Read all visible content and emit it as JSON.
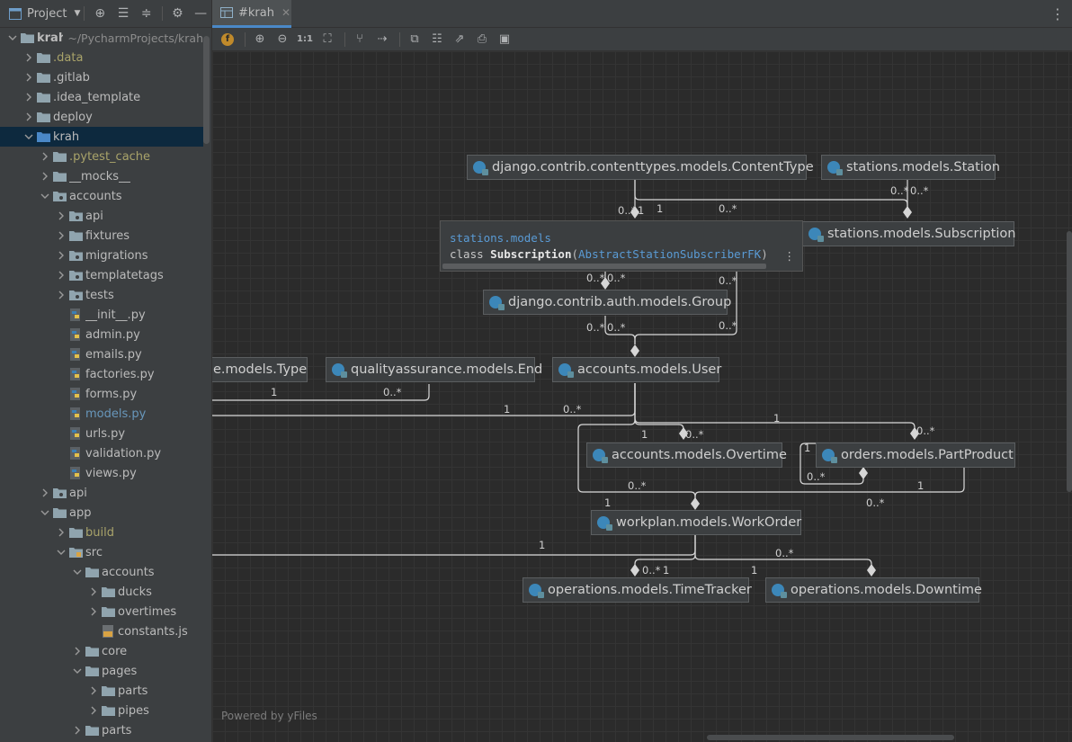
{
  "project_panel": {
    "title": "Project",
    "tree": [
      {
        "label": "krah",
        "path": "~/PycharmProjects/krah",
        "depth": 0,
        "type": "folder",
        "expanded": true,
        "bold": true
      },
      {
        "label": ".data",
        "depth": 1,
        "type": "folder",
        "expanded": false,
        "style": "excluded"
      },
      {
        "label": ".gitlab",
        "depth": 1,
        "type": "folder",
        "expanded": false
      },
      {
        "label": ".idea_template",
        "depth": 1,
        "type": "folder",
        "expanded": false
      },
      {
        "label": "deploy",
        "depth": 1,
        "type": "folder",
        "expanded": false
      },
      {
        "label": "krah",
        "depth": 1,
        "type": "folder-blue",
        "expanded": true,
        "selected": true
      },
      {
        "label": ".pytest_cache",
        "depth": 2,
        "type": "folder",
        "expanded": false,
        "style": "excluded"
      },
      {
        "label": "__mocks__",
        "depth": 2,
        "type": "folder",
        "expanded": false
      },
      {
        "label": "accounts",
        "depth": 2,
        "type": "folder-pkg",
        "expanded": true
      },
      {
        "label": "api",
        "depth": 3,
        "type": "folder-pkg",
        "expanded": false
      },
      {
        "label": "fixtures",
        "depth": 3,
        "type": "folder",
        "expanded": false
      },
      {
        "label": "migrations",
        "depth": 3,
        "type": "folder-pkg",
        "expanded": false
      },
      {
        "label": "templatetags",
        "depth": 3,
        "type": "folder-pkg",
        "expanded": false
      },
      {
        "label": "tests",
        "depth": 3,
        "type": "folder-pkg",
        "expanded": false
      },
      {
        "label": "__init__.py",
        "depth": 3,
        "type": "py"
      },
      {
        "label": "admin.py",
        "depth": 3,
        "type": "py"
      },
      {
        "label": "emails.py",
        "depth": 3,
        "type": "py"
      },
      {
        "label": "factories.py",
        "depth": 3,
        "type": "py"
      },
      {
        "label": "forms.py",
        "depth": 3,
        "type": "py"
      },
      {
        "label": "models.py",
        "depth": 3,
        "type": "py",
        "style": "modified"
      },
      {
        "label": "urls.py",
        "depth": 3,
        "type": "py"
      },
      {
        "label": "validation.py",
        "depth": 3,
        "type": "py"
      },
      {
        "label": "views.py",
        "depth": 3,
        "type": "py"
      },
      {
        "label": "api",
        "depth": 2,
        "type": "folder-pkg",
        "expanded": false
      },
      {
        "label": "app",
        "depth": 2,
        "type": "folder",
        "expanded": true
      },
      {
        "label": "build",
        "depth": 3,
        "type": "folder",
        "expanded": false,
        "style": "excluded"
      },
      {
        "label": "src",
        "depth": 3,
        "type": "folder-src",
        "expanded": true
      },
      {
        "label": "accounts",
        "depth": 4,
        "type": "folder",
        "expanded": true
      },
      {
        "label": "ducks",
        "depth": 5,
        "type": "folder",
        "expanded": false
      },
      {
        "label": "overtimes",
        "depth": 5,
        "type": "folder",
        "expanded": false
      },
      {
        "label": "constants.js",
        "depth": 5,
        "type": "js"
      },
      {
        "label": "core",
        "depth": 4,
        "type": "folder",
        "expanded": false
      },
      {
        "label": "pages",
        "depth": 4,
        "type": "folder",
        "expanded": true
      },
      {
        "label": "parts",
        "depth": 5,
        "type": "folder",
        "expanded": false
      },
      {
        "label": "pipes",
        "depth": 5,
        "type": "folder",
        "expanded": false
      },
      {
        "label": "parts",
        "depth": 4,
        "type": "folder",
        "expanded": false
      }
    ]
  },
  "editor": {
    "tab_label": "#krah"
  },
  "diagram": {
    "nodes": [
      {
        "id": "contenttype",
        "label": "django.contrib.contenttypes.models.ContentType"
      },
      {
        "id": "station",
        "label": "stations.models.Station"
      },
      {
        "id": "subscription",
        "label": "stations.models.Subscription"
      },
      {
        "id": "group",
        "label": "django.contrib.auth.models.Group"
      },
      {
        "id": "type",
        "label": "e.models.Type"
      },
      {
        "id": "qa_end",
        "label": "qualityassurance.models.End"
      },
      {
        "id": "user",
        "label": "accounts.models.User"
      },
      {
        "id": "overtime",
        "label": "accounts.models.Overtime"
      },
      {
        "id": "partproduct",
        "label": "orders.models.PartProduct"
      },
      {
        "id": "workorder",
        "label": "workplan.models.WorkOrder"
      },
      {
        "id": "timetracker",
        "label": "operations.models.TimeTracker"
      },
      {
        "id": "downtime",
        "label": "operations.models.Downtime"
      }
    ],
    "multiplicities": [
      "0..*",
      "1",
      "1",
      "0..*",
      "0..*",
      "0..*",
      "0..*",
      "0..*",
      "0..*",
      "0..*",
      "0..*",
      "0..*",
      "1",
      "0..*",
      "1",
      "0..*",
      "1",
      "1",
      "0..*",
      "0..*",
      "1",
      "0..*",
      "1",
      "0..*",
      "1",
      "0..*",
      "1",
      "0..*",
      "1",
      "1",
      "0..*"
    ],
    "tooltip": {
      "package": "stations.models",
      "keyword": "class",
      "class_name": "Subscription",
      "base_class": "AbstractStationSubscriberFK"
    },
    "powered_by": "Powered by yFiles"
  },
  "colors": {
    "accent": "#4a88c7",
    "selection": "#0d293e",
    "excluded_text": "#a9a36a",
    "modified_text": "#6897bb"
  }
}
